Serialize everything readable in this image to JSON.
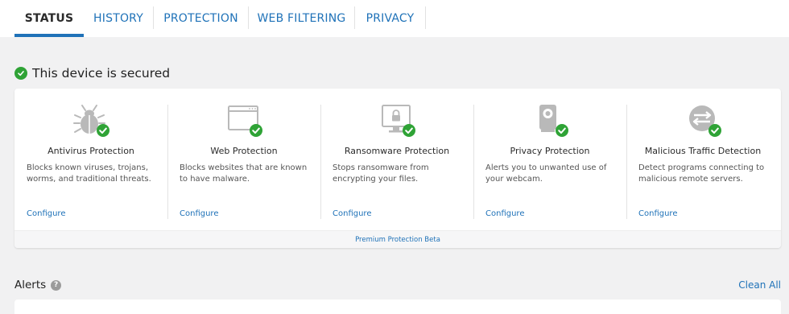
{
  "tabs": [
    {
      "label": "STATUS",
      "active": true
    },
    {
      "label": "HISTORY",
      "active": false
    },
    {
      "label": "PROTECTION",
      "active": false
    },
    {
      "label": "WEB FILTERING",
      "active": false
    },
    {
      "label": "PRIVACY",
      "active": false
    }
  ],
  "status": {
    "title": "This device is secured",
    "icon": "check-circle-icon"
  },
  "features": [
    {
      "name": "Antivirus Protection",
      "desc": "Blocks known viruses, trojans, worms, and traditional threats.",
      "link": "Configure",
      "icon": "bug-icon"
    },
    {
      "name": "Web Protection",
      "desc": "Blocks websites that are known to have malware.",
      "link": "Configure",
      "icon": "browser-window-icon"
    },
    {
      "name": "Ransomware Protection",
      "desc": "Stops ransomware from encrypting your files.",
      "link": "Configure",
      "icon": "locked-monitor-icon"
    },
    {
      "name": "Privacy Protection",
      "desc": "Alerts you to unwanted use of your webcam.",
      "link": "Configure",
      "icon": "webcam-icon"
    },
    {
      "name": "Malicious Traffic Detection",
      "desc": "Detect programs connecting to malicious remote servers.",
      "link": "Configure",
      "icon": "traffic-arrows-icon"
    }
  ],
  "footer": {
    "link": "Premium Protection Beta"
  },
  "alerts": {
    "title": "Alerts",
    "help": "?",
    "clean_all": "Clean All"
  },
  "colors": {
    "accent": "#1f72b8",
    "ok": "#2fa336",
    "icon_gray": "#b9b9b9"
  }
}
